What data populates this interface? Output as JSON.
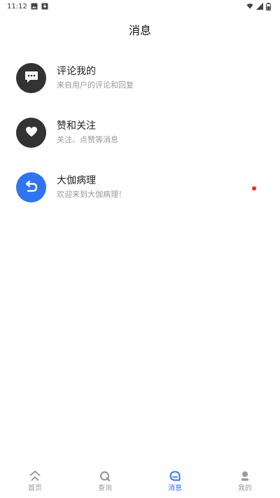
{
  "status_bar": {
    "time": "11:12"
  },
  "header": {
    "title": "消息"
  },
  "messages": [
    {
      "title": "评论我的",
      "subtitle": "来自用户的评论和回复",
      "icon": "chat-bubble-icon",
      "unread": false
    },
    {
      "title": "赞和关注",
      "subtitle": "关注、点赞等消息",
      "icon": "heart-icon",
      "unread": false
    },
    {
      "title": "大伽病理",
      "subtitle": "欢迎来到大伽病理！",
      "icon": "return-arrow-icon",
      "unread": true
    }
  ],
  "bottom_nav": {
    "items": [
      {
        "label": "首页",
        "icon": "home-icon",
        "active": false
      },
      {
        "label": "查询",
        "icon": "search-icon",
        "active": false
      },
      {
        "label": "消息",
        "icon": "message-icon",
        "active": true
      },
      {
        "label": "我的",
        "icon": "user-icon",
        "active": false
      }
    ]
  },
  "colors": {
    "accent": "#2f74f0",
    "dark_avatar": "#333333",
    "unread_dot": "#ee2b2b",
    "inactive_nav": "#9a9a9a"
  }
}
